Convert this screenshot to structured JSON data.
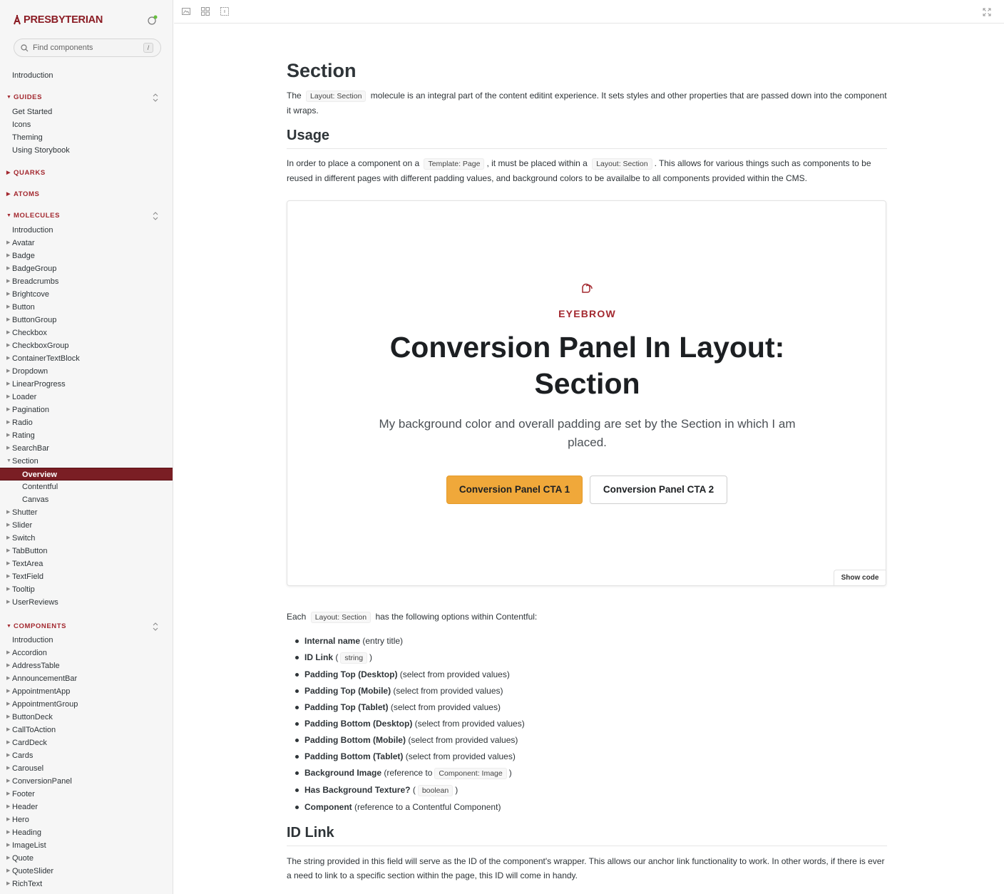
{
  "brand": {
    "name": "PRESBYTERIAN",
    "color": "#8b1c24"
  },
  "search": {
    "placeholder": "Find components",
    "shortcut": "/"
  },
  "sidebar": {
    "intro": "Introduction",
    "guides": {
      "label": "GUIDES",
      "items": [
        "Get Started",
        "Icons",
        "Theming",
        "Using Storybook"
      ]
    },
    "quarks": {
      "label": "QUARKS"
    },
    "atoms": {
      "label": "ATOMS"
    },
    "molecules": {
      "label": "MOLECULES",
      "items": [
        "Introduction",
        "Avatar",
        "Badge",
        "BadgeGroup",
        "Breadcrumbs",
        "Brightcove",
        "Button",
        "ButtonGroup",
        "Checkbox",
        "CheckboxGroup",
        "ContainerTextBlock",
        "Dropdown",
        "LinearProgress",
        "Loader",
        "Pagination",
        "Radio",
        "Rating",
        "SearchBar",
        "Section"
      ],
      "section_children": [
        "Overview",
        "Contentful",
        "Canvas"
      ],
      "items_after": [
        "Shutter",
        "Slider",
        "Switch",
        "TabButton",
        "TextArea",
        "TextField",
        "Tooltip",
        "UserReviews"
      ]
    },
    "components": {
      "label": "COMPONENTS",
      "items": [
        "Introduction",
        "Accordion",
        "AddressTable",
        "AnnouncementBar",
        "AppointmentApp",
        "AppointmentGroup",
        "ButtonDeck",
        "CallToAction",
        "CardDeck",
        "Cards",
        "Carousel",
        "ConversionPanel",
        "Footer",
        "Header",
        "Hero",
        "Heading",
        "ImageList",
        "Quote",
        "QuoteSlider",
        "RichText"
      ]
    }
  },
  "doc": {
    "title": "Section",
    "intro": {
      "pre": "The",
      "code": "Layout: Section",
      "post": "molecule is an integral part of the content editint experience. It sets styles and other properties that are passed down into the component it wraps."
    },
    "usage_heading": "Usage",
    "usage": {
      "p1": "In order to place a component on a",
      "code1": "Template: Page",
      "p2": ", it must be placed within a",
      "code2": "Layout: Section",
      "p3": ". This allows for various things such as components to be reused in different pages with different padding values, and background colors to be availalbe to all components provided within the CMS."
    },
    "preview": {
      "eyebrow": "EYEBROW",
      "heading_line1": "Conversion Panel In Layout:",
      "heading_line2": "Section",
      "body": "My background color and overall padding are set by the Section in which I am placed.",
      "cta1": "Conversion Panel CTA 1",
      "cta2": "Conversion Panel CTA 2",
      "show_code": "Show code",
      "accent": "#f0a83a"
    },
    "options_intro": {
      "pre": "Each",
      "code": "Layout: Section",
      "post": "has the following options within Contentful:"
    },
    "options": [
      {
        "name": "Internal name",
        "desc": " (entry title)"
      },
      {
        "name": "ID Link",
        "desc": " (",
        "code": "string",
        "after": ")"
      },
      {
        "name": "Padding Top (Desktop)",
        "desc": " (select from provided values)"
      },
      {
        "name": "Padding Top (Mobile)",
        "desc": " (select from provided values)"
      },
      {
        "name": "Padding Top (Tablet)",
        "desc": " (select from provided values)"
      },
      {
        "name": "Padding Bottom (Desktop)",
        "desc": " (select from provided values)"
      },
      {
        "name": "Padding Bottom (Mobile)",
        "desc": " (select from provided values)"
      },
      {
        "name": "Padding Bottom (Tablet)",
        "desc": " (select from provided values)"
      },
      {
        "name": "Background Image",
        "desc": " (reference to",
        "code": "Component: Image",
        "after": ")"
      },
      {
        "name": "Has Background Texture?",
        "desc": " (",
        "code": "boolean",
        "after": ")"
      },
      {
        "name": "Component",
        "desc": " (reference to a Contentful Component)"
      }
    ],
    "idlink_heading": "ID Link",
    "idlink_text": "The string provided in this field will serve as the ID of the component's wrapper. This allows our anchor link functionality to work. In other words, if there is ever a need to link to a specific section within the page, this ID will come in handy."
  }
}
